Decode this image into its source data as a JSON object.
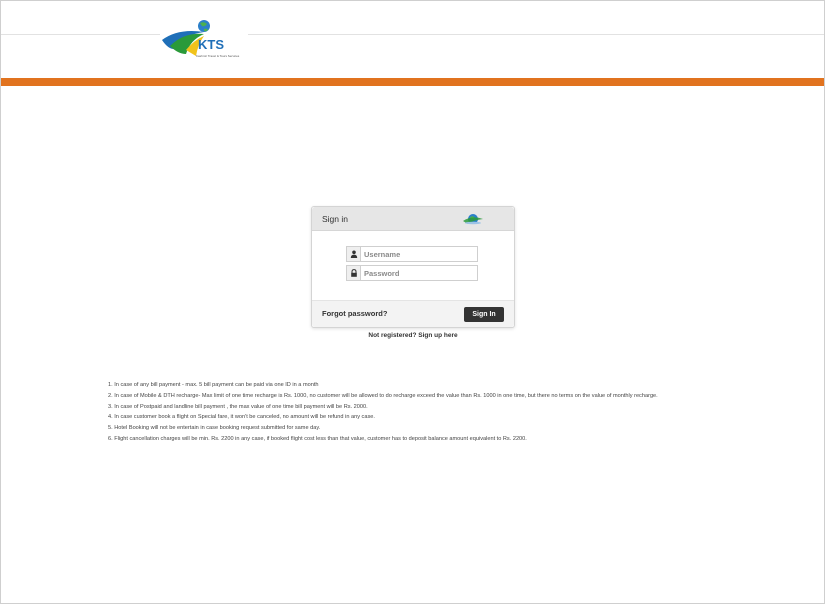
{
  "logo": {
    "text": "KTS",
    "tagline": "Kashmir Travel & Tours Services"
  },
  "colors": {
    "accent_orange": "#e1731f",
    "button_dark": "#333333",
    "panel_header": "#e6e6e6",
    "logo_blue": "#1f6fb8",
    "logo_green": "#2a9a3a",
    "logo_yellow": "#f1c31b"
  },
  "signin": {
    "title": "Sign in",
    "username_placeholder": "Username",
    "username_icon": "user-icon",
    "password_placeholder": "Password",
    "password_icon": "lock-icon",
    "forgot_label": "Forgot password?",
    "button_label": "Sign In",
    "register_label": "Not registered? Sign up here"
  },
  "notes": [
    "1. In case of any bill payment - max. 5 bill payment can be paid via one ID in a month",
    "2. In case of Mobile & DTH recharge- Max limit of one time recharge is Rs. 1000, no customer will be allowed to do recharge exceed the value than Rs. 1000 in one time, but there no terms on the value of monthly recharge.",
    "3. In case of Postpaid and landline bill payment , the max value of one time bill payment will be Rs. 2000.",
    "4. In case customer book a flight on Special fare, it won't be canceled, no amount will be refund in any case.",
    "5. Hotel Booking will not be entertain in case booking request submitted for same day.",
    "6. Flight cancellation charges will be min. Rs. 2200 in any case, if booked flight cost less than that value, customer has to deposit balance amount equivalent to Rs. 2200."
  ]
}
